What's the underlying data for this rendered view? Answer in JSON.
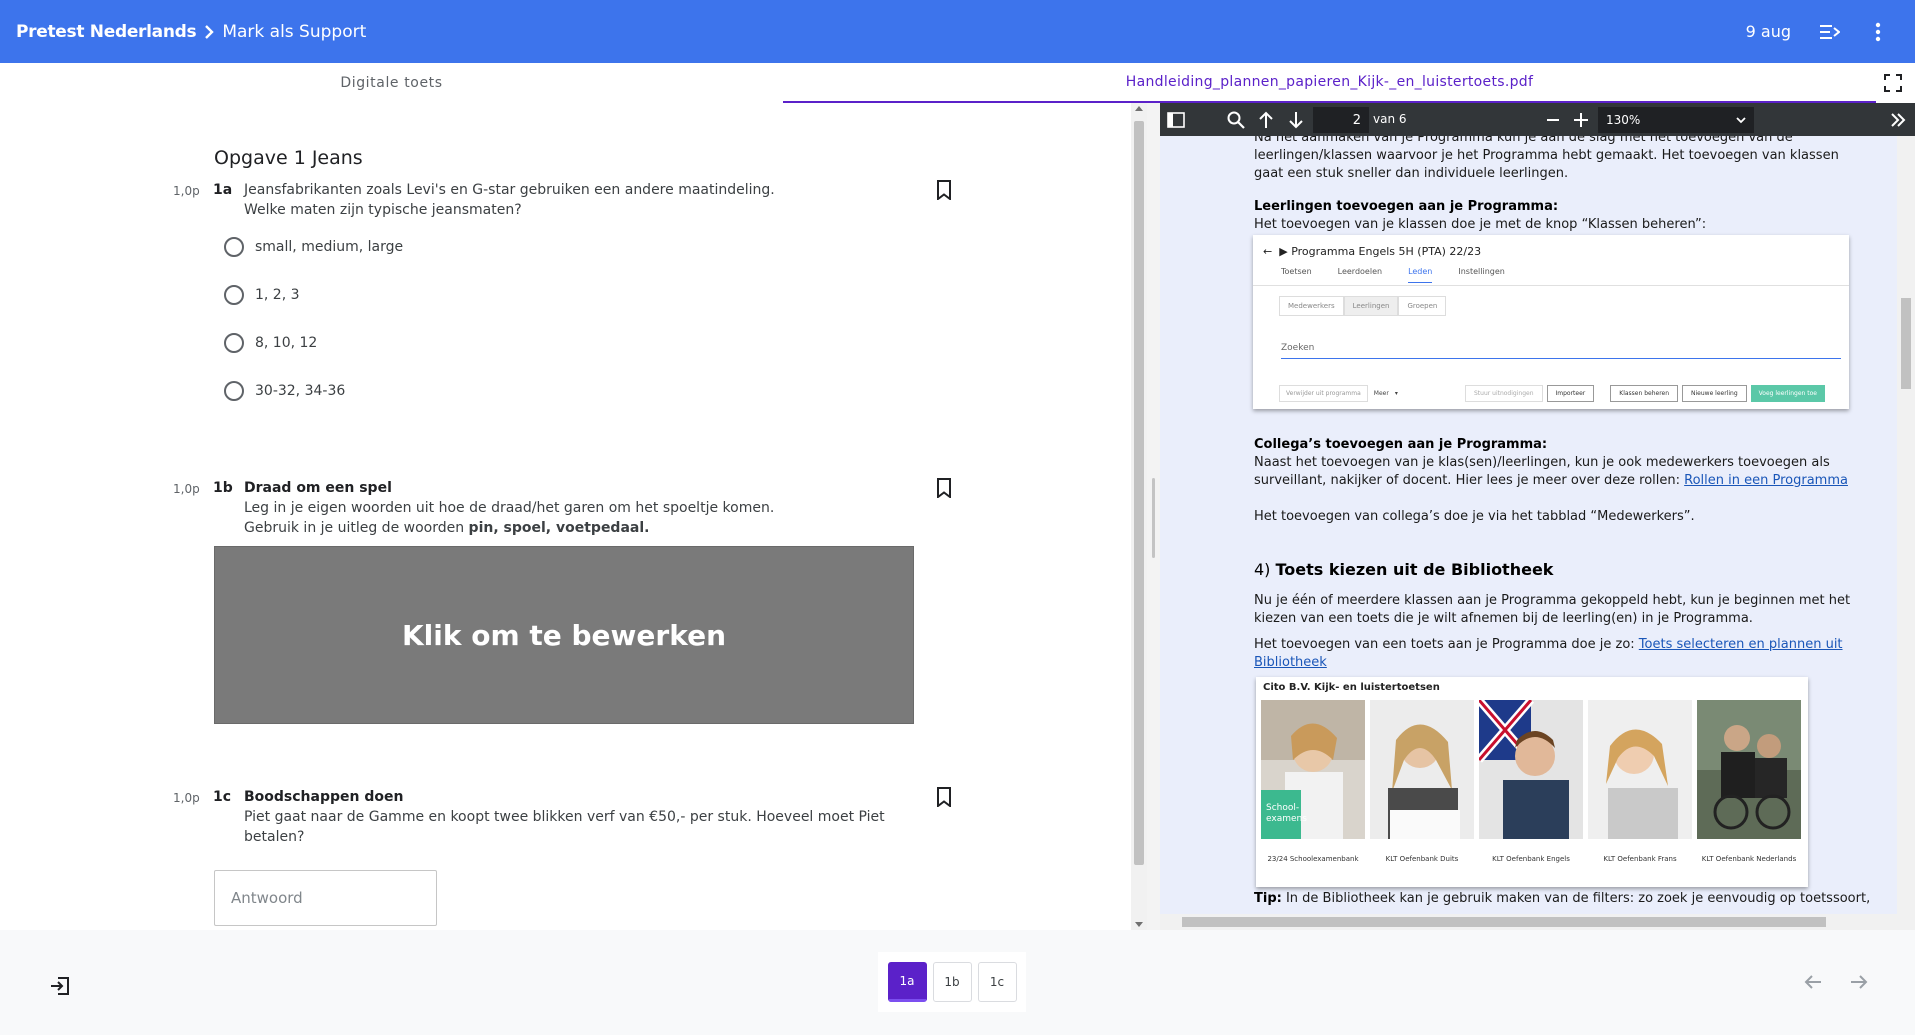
{
  "header": {
    "crumb_root": "Pretest Nederlands",
    "crumb_current": "Mark als Support",
    "date": "9 aug"
  },
  "tabs": {
    "digital": "Digitale toets",
    "pdf": "Handleiding_plannen_papieren_Kijk-_en_luistertoets.pdf"
  },
  "test": {
    "opgave_title": "Opgave 1 Jeans",
    "questions": [
      {
        "points": "1,0p",
        "number": "1a",
        "line1": "Jeansfabrikanten zoals Levi's en G-star gebruiken een andere maatindeling.",
        "line2": "Welke maten zijn typische jeansmaten?",
        "options": [
          "small, medium, large",
          "1, 2, 3",
          "8, 10, 12",
          "30-32, 34-36"
        ]
      },
      {
        "points": "1,0p",
        "number": "1b",
        "title": "Draad om een spel",
        "line1": "Leg in je eigen woorden uit hoe de draad/het garen om het spoeltje komen.",
        "line2_prefix": "Gebruik in je uitleg de woorden ",
        "line2_bold": "pin, spoel, voetpedaal.",
        "edit_label": "Klik om te bewerken"
      },
      {
        "points": "1,0p",
        "number": "1c",
        "title": "Boodschappen doen",
        "line1": "Piet gaat naar de Gamme en koopt twee blikken verf van €50,- per stuk. Hoeveel moet Piet",
        "line2": "betalen?",
        "answer_placeholder": "Antwoord"
      }
    ]
  },
  "pdf": {
    "page_current": "2",
    "page_of": "van 6",
    "zoom": "130%",
    "para1_l1": "Na het aanmaken van je Programma kun je aan de slag met het toevoegen van de",
    "para1_l2": "leerlingen/klassen waarvoor je het Programma hebt gemaakt. Het toevoegen van klassen",
    "para1_l3": "gaat een stuk sneller dan individuele leerlingen.",
    "h_leerlingen": "Leerlingen toevoegen aan je Programma:",
    "leerlingen_text": "Het toevoegen van je klassen doe je met de knop “Klassen beheren”:",
    "shot1": {
      "title": "Programma Engels 5H (PTA) 22/23",
      "tabs": [
        "Toetsen",
        "Leerdoelen",
        "Leden",
        "Instellingen"
      ],
      "subtabs": [
        "Medewerkers",
        "Leerlingen",
        "Groepen"
      ],
      "search": "Zoeken",
      "btn_remove": "Verwijder uit programma",
      "btn_more": "Meer",
      "btn_invites": "Stuur uitnodigingen",
      "btn_import": "Importeer",
      "btn_classes": "Klassen beheren",
      "btn_new": "Nieuwe leerling",
      "btn_add": "Voeg leerlingen toe"
    },
    "h_collegas": "Collega’s toevoegen aan je Programma:",
    "collegas_l1": "Naast het toevoegen van je klas(sen)/leerlingen, kun je ook medewerkers toevoegen als",
    "collegas_l2_prefix": "surveillant, nakijker of docent. Hier lees je meer over deze rollen: ",
    "collegas_link": "Rollen in een Programma",
    "collegas_tab_text": "Het toevoegen van collega’s doe je via het tabblad “Medewerkers”.",
    "h4_prefix": "4) ",
    "h4_title": "Toets kiezen uit de Bibliotheek",
    "bib_l1": "Nu je één of meerdere klassen aan je Programma gekoppeld hebt, kun je beginnen met het",
    "bib_l2": "kiezen van een toets die je wilt afnemen bij de leerling(en) in je Programma.",
    "bib_l3_prefix": "Het toevoegen van een toets aan je Programma doe je zo: ",
    "bib_link_l1": "Toets selecteren en plannen uit",
    "bib_link_l2": "Bibliotheek",
    "shot2": {
      "title": "Cito B.V. Kijk- en luistertoetsen",
      "badge": "School-\nexamens",
      "labels": [
        "23/24 Schoolexamenbank",
        "KLT Oefenbank Duits",
        "KLT Oefenbank Engels",
        "KLT Oefenbank Frans",
        "KLT Oefenbank Nederlands"
      ]
    },
    "tip_label": "Tip:",
    "tip_text": " In de Bibliotheek kan je gebruik maken van de filters: zo zoek je eenvoudig op toetssoort,"
  },
  "footer": {
    "pages": [
      "1a",
      "1b",
      "1c"
    ],
    "active_page": "1a"
  },
  "icons": {
    "header": [
      "chevron-right-icon",
      "menu-collapse-icon",
      "more-vert-icon"
    ],
    "tabs": [
      "fullscreen-icon"
    ],
    "pdf_toolbar": [
      "sidebar-toggle-icon",
      "search-icon",
      "arrow-up-icon",
      "arrow-down-icon",
      "minus-icon",
      "plus-icon",
      "chevron-down-icon",
      "double-chevron-right-icon"
    ],
    "footer": [
      "exit-icon",
      "arrow-left-icon",
      "arrow-right-icon"
    ],
    "question": [
      "bookmark-icon"
    ]
  },
  "colors": {
    "header_bg": "#3d74ec",
    "accent": "#5b21c9",
    "pdf_toolbar_bg": "#323639",
    "pdf_page_bg": "#eaeefb",
    "edit_box_bg": "#7a7a7a",
    "green_button": "#5bc8a8"
  }
}
